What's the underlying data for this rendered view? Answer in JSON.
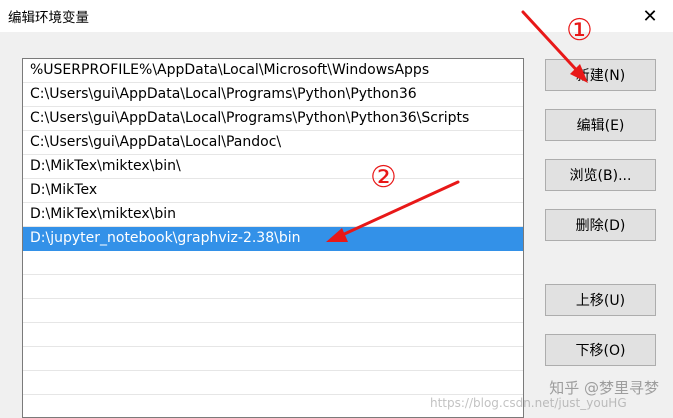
{
  "window": {
    "title": "编辑环境变量",
    "close_glyph": "✕"
  },
  "list": {
    "items": [
      "%USERPROFILE%\\AppData\\Local\\Microsoft\\WindowsApps",
      "C:\\Users\\gui\\AppData\\Local\\Programs\\Python\\Python36",
      "C:\\Users\\gui\\AppData\\Local\\Programs\\Python\\Python36\\Scripts",
      "C:\\Users\\gui\\AppData\\Local\\Pandoc\\",
      "D:\\MikTex\\miktex\\bin\\",
      "D:\\MikTex",
      "D:\\MikTex\\miktex\\bin",
      "D:\\jupyter_notebook\\graphviz-2.38\\bin"
    ],
    "selected_index": 7
  },
  "buttons": {
    "new": "新建(N)",
    "edit": "编辑(E)",
    "browse": "浏览(B)...",
    "delete": "删除(D)",
    "move_up": "上移(U)",
    "move_down": "下移(O)"
  },
  "annotations": {
    "marker_1": "①",
    "marker_2": "②",
    "color": "#e81818"
  },
  "watermark": {
    "text": "知乎 @梦里寻梦",
    "url": "https://blog.csdn.net/just_youHG"
  }
}
